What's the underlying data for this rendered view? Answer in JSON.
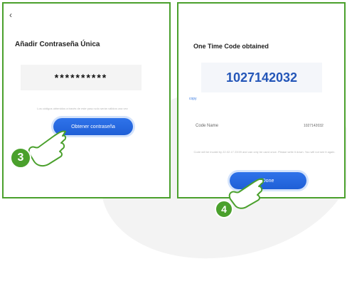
{
  "left": {
    "back_icon": "‹",
    "title": "Añadir Contraseña Única",
    "password_mask": "**********",
    "hint": "Los códigos obtenidos a través de este paso solo serán válidos una vez",
    "get_button": "Obtener contraseña",
    "step": "3"
  },
  "right": {
    "title": "One Time Code obtained",
    "code": "1027142032",
    "copy": "copy",
    "code_name_label": "Code Name",
    "code_name_value": "1027142032",
    "hint": "Code will be invalid by 22.02.17 23:59 and can only be used once. Please write it down. You will not see it again.",
    "done_button": "Done",
    "step": "4"
  },
  "colors": {
    "accent": "#4aa02c",
    "button": "#1f5fd6",
    "code": "#2456b8"
  }
}
